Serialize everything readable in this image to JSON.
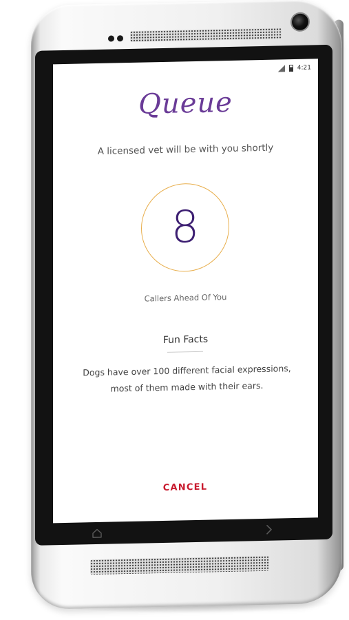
{
  "status_bar": {
    "time": "4:21",
    "icons": [
      "signal-icon",
      "battery-icon"
    ]
  },
  "queue": {
    "title": "Queue",
    "subtitle": "A licensed vet will be with you shortly",
    "callers_ahead": "8",
    "callers_label": "Callers Ahead Of You"
  },
  "fun_facts": {
    "heading": "Fun Facts",
    "text": "Dogs have over 100 different facial expressions, most of them made with their ears."
  },
  "actions": {
    "cancel_label": "CANCEL"
  },
  "nav": {
    "icons": [
      "home-icon",
      "forward-arrow-icon"
    ]
  },
  "colors": {
    "title": "#6a3b97",
    "ring": "#e8ae4c",
    "number": "#3d1f72",
    "cancel": "#c8192d"
  }
}
